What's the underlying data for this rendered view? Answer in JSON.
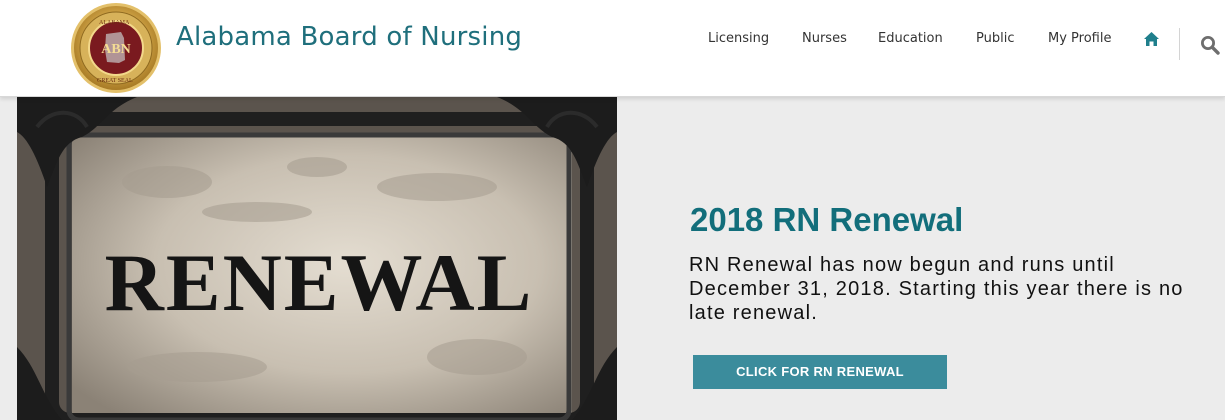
{
  "header": {
    "seal_text": {
      "monogram": "ABN",
      "ring_top": "ALABAMA",
      "ring_bottom": "GREAT SEAL"
    },
    "site_title": "Alabama Board of Nursing",
    "nav": [
      {
        "label": "Licensing"
      },
      {
        "label": "Nurses"
      },
      {
        "label": "Education"
      },
      {
        "label": "Public"
      },
      {
        "label": "My Profile"
      }
    ],
    "icons": [
      "home-icon",
      "search-icon"
    ]
  },
  "hero": {
    "image_word": "RENEWAL",
    "title": "2018 RN Renewal",
    "body": "RN Renewal has now begun and runs until December 31, 2018. Starting this year there is no late renewal.",
    "cta_label": "CLICK FOR RN RENEWAL"
  },
  "colors": {
    "brand_teal": "#1f6f7c",
    "title_teal": "#126e7b",
    "button": "#3b8c9c",
    "background": "#ececec"
  }
}
